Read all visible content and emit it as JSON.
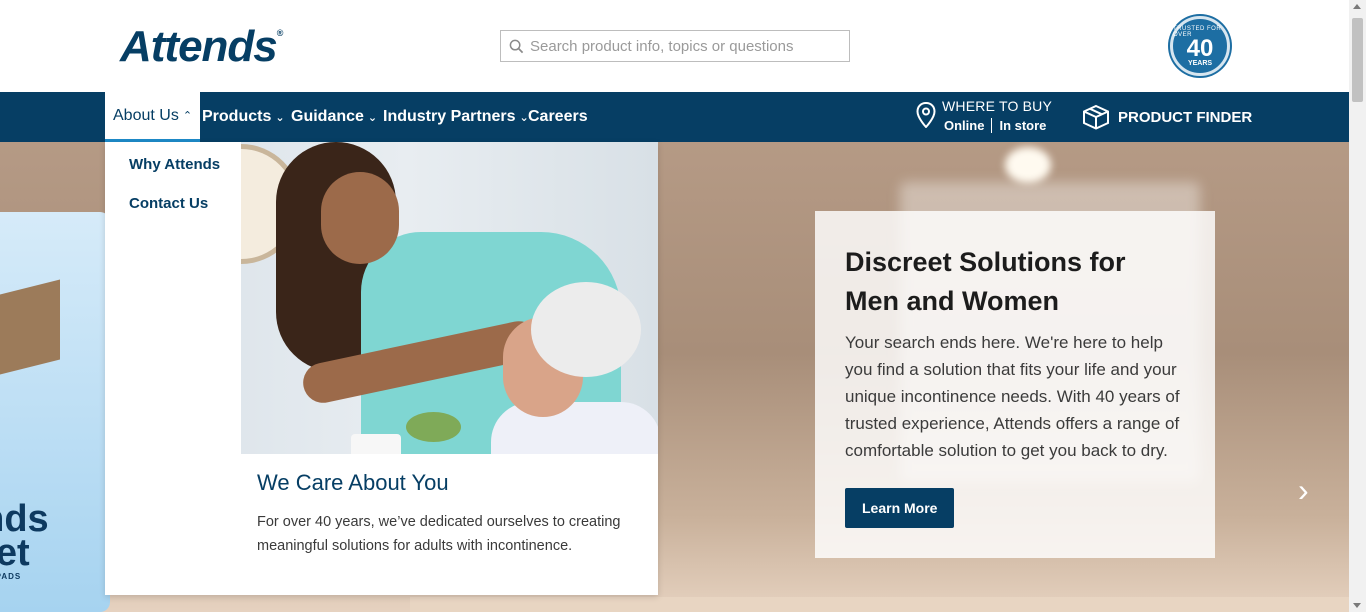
{
  "header": {
    "logo_text": "Attends",
    "logo_mark": "®",
    "search_placeholder": "Search product info, topics or questions",
    "badge": {
      "top": "TRUSTED FOR OVER",
      "number": "40",
      "bottom": "YEARS"
    }
  },
  "nav": {
    "items": [
      {
        "label": "About Us",
        "chevron": "⌃"
      },
      {
        "label": "Products",
        "chevron": "⌄"
      },
      {
        "label": "Guidance",
        "chevron": "⌄"
      },
      {
        "label": "Industry Partners",
        "chevron": "⌄"
      },
      {
        "label": "Careers"
      }
    ],
    "where_to_buy": {
      "title": "WHERE TO BUY",
      "online": "Online",
      "in_store": "In store"
    },
    "product_finder": "PRODUCT FINDER"
  },
  "dropdown": {
    "links": [
      "Why Attends",
      "Contact Us"
    ],
    "card_title": "We Care About You",
    "card_text": "For over 40 years, we’ve dedicated ourselves to creating meaningful solutions for adults with incontinence."
  },
  "hero": {
    "title": "Discreet Solutions for Men and Women",
    "text": "Your search ends here. We're here to help you find a solution that fits your life and your unique incontinence needs. With 40 years of trusted experience, Attends offers a range of comfortable solution to get you back to dry.",
    "button": "Learn More",
    "product_text1": "ends",
    "product_text2": "reet",
    "product_text3": "NTROL PADS",
    "next_arrow": "›"
  },
  "colors": {
    "navy": "#063e64",
    "accent": "#1d8ac8"
  }
}
